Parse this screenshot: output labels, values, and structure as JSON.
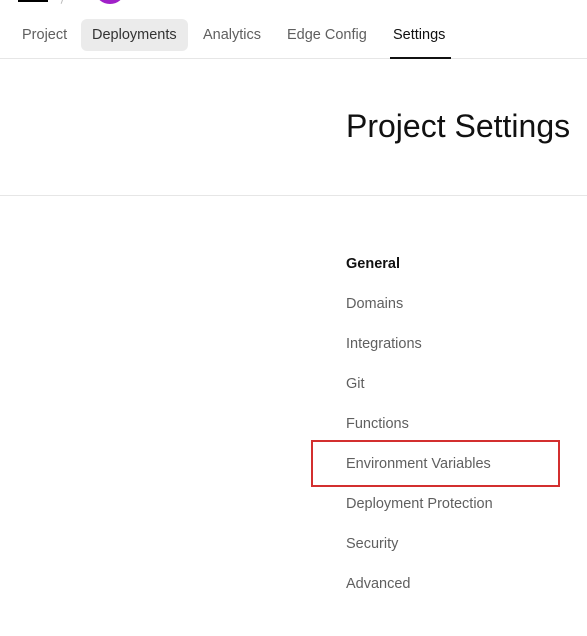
{
  "tabs": [
    {
      "label": "Project"
    },
    {
      "label": "Deployments"
    },
    {
      "label": "Analytics"
    },
    {
      "label": "Edge Config"
    },
    {
      "label": "Settings"
    }
  ],
  "page": {
    "title": "Project Settings"
  },
  "settings_nav": {
    "items": [
      {
        "label": "General"
      },
      {
        "label": "Domains"
      },
      {
        "label": "Integrations"
      },
      {
        "label": "Git"
      },
      {
        "label": "Functions"
      },
      {
        "label": "Environment Variables"
      },
      {
        "label": "Deployment Protection"
      },
      {
        "label": "Security"
      },
      {
        "label": "Advanced"
      }
    ]
  },
  "colors": {
    "avatar": "#a020c8",
    "highlight": "#d32f2f",
    "hover_tab_bg": "#ebebeb"
  }
}
